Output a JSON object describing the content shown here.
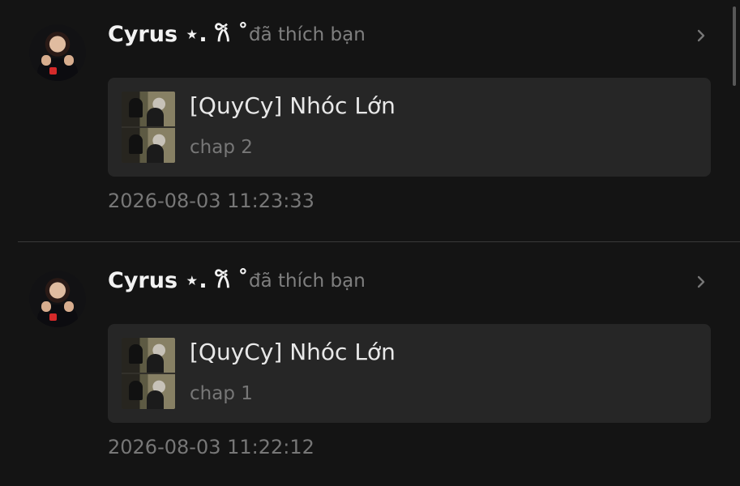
{
  "notifications": [
    {
      "username": "Cyrus ⋆. 𐙚 ˚",
      "action": "đã thích bạn",
      "post": {
        "title": "[QuyCy] Nhóc Lớn",
        "chapter": "chap 2"
      },
      "timestamp": "2026-08-03 11:23:33"
    },
    {
      "username": "Cyrus ⋆. 𐙚 ˚",
      "action": "đã thích bạn",
      "post": {
        "title": "[QuyCy] Nhóc Lớn",
        "chapter": "chap 1"
      },
      "timestamp": "2026-08-03 11:22:12"
    }
  ],
  "icons": {
    "chevron": "chevron-right-icon"
  },
  "colors": {
    "background": "#141414",
    "card": "#262626",
    "primary_text": "#f2f2f2",
    "secondary_text": "#777777",
    "divider": "#3a3a3a"
  }
}
